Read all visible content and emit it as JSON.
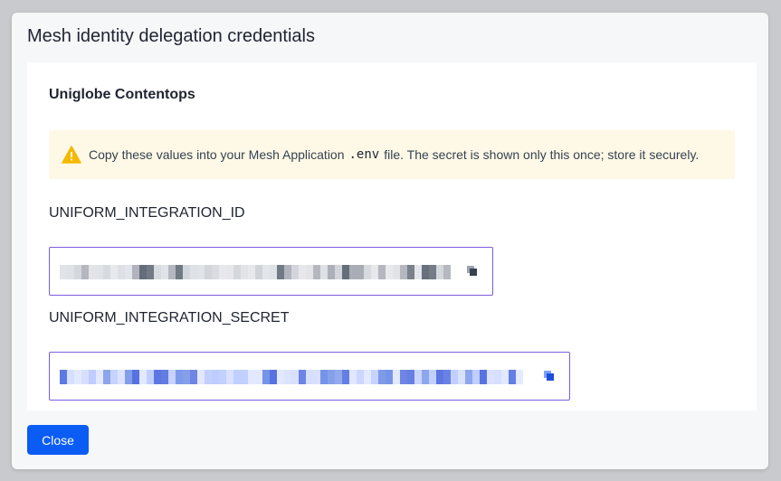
{
  "dialog": {
    "title": "Mesh identity delegation credentials",
    "close_label": "Close"
  },
  "org": {
    "name": "Uniglobe Contentops"
  },
  "alert": {
    "icon": "warning-triangle-icon",
    "text_before": "Copy these values into your Mesh Application",
    "code": ".env",
    "text_after": "file. The secret is shown only this once; store it securely."
  },
  "fields": [
    {
      "label": "UNIFORM_INTEGRATION_ID",
      "value_state": "obscured",
      "copy_icon": "copy-icon"
    },
    {
      "label": "UNIFORM_INTEGRATION_SECRET",
      "value_state": "obscured",
      "copy_icon": "copy-icon"
    }
  ],
  "colors": {
    "primary": "#0b5cf5",
    "field_border": "#7c5ce0",
    "alert_bg": "#fdf9e6",
    "warning": "#f5b800"
  }
}
